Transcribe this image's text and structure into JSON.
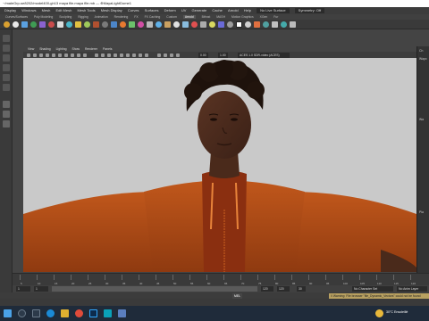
{
  "window": {
    "title": "~/maleGrp-se8202/model400-gh13 maya file.maya file.mb — ⊕MayaLightDome1"
  },
  "menu": {
    "items": [
      "Display",
      "Windows",
      "Mesh",
      "Edit Mesh",
      "Mesh Tools",
      "Mesh Display",
      "Curves",
      "Surfaces",
      "Deform",
      "UV",
      "Generate",
      "Cache",
      "Arnold",
      "Help"
    ],
    "live_surface": "No Live Surface",
    "symmetry": "Symmetry: Off"
  },
  "shelf_tabs": [
    "Curves/Surfaces",
    "Poly Modeling",
    "Sculpting",
    "Rigging",
    "Animation",
    "Rendering",
    "FX",
    "FX Caching",
    "Custom",
    "Arnold",
    "Bifrost",
    "MASH",
    "Motion Graphics",
    "XGen",
    "Fur"
  ],
  "shelf_active": "Arnold",
  "panel_menu": [
    "View",
    "Shading",
    "Lighting",
    "Show",
    "Renderer",
    "Panels"
  ],
  "panel_toolbar": {
    "gamma": "0.00",
    "exposure": "1.00",
    "color_space": "ACES 1.0 SDR-video (ACES)"
  },
  "right_panel": {
    "items": [
      "Ch",
      "Wayo",
      "Wa",
      "Pla"
    ]
  },
  "timeline": {
    "ticks": [
      "5",
      "10",
      "15",
      "20",
      "25",
      "30",
      "35",
      "40",
      "45",
      "50",
      "55",
      "60",
      "65",
      "70",
      "75",
      "80",
      "85",
      "90",
      "95",
      "100",
      "105",
      "110",
      "115",
      "120"
    ]
  },
  "range": {
    "start": "1",
    "start_inner": "1",
    "end_inner": "120",
    "end": "120",
    "fps": "30",
    "character_set": "No Character Set",
    "anim_layer": "No Anim Layer",
    "fps_label": "24 fps"
  },
  "mel": {
    "label": "MEL",
    "warning": "// Warning: File browser \"file_Dynamic_Vectors\" could not be found"
  },
  "taskbar": {
    "weather": "30°C Ensoleillé",
    "apps": [
      "start",
      "search",
      "task-view",
      "edge",
      "explorer",
      "chrome",
      "photoshop",
      "maya",
      "store"
    ]
  },
  "colors": {
    "viewport_bg": "#c9c9c9",
    "ui_dark": "#3a3a3a",
    "taskbar": "#1f2b3a",
    "hoodie": "#c0571b"
  }
}
